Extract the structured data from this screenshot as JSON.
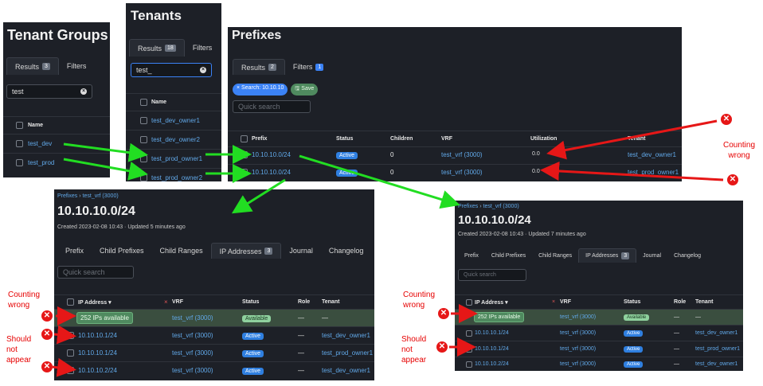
{
  "tenant_groups": {
    "title": "Tenant Groups",
    "tabs": [
      {
        "label": "Results",
        "count": "3"
      },
      {
        "label": "Filters"
      }
    ],
    "search_value": "test",
    "columns": [
      "Name"
    ],
    "rows": [
      "test_dev",
      "test_prod"
    ]
  },
  "tenants": {
    "title": "Tenants",
    "tabs": [
      {
        "label": "Results",
        "count": "18"
      },
      {
        "label": "Filters"
      }
    ],
    "search_value": "test_",
    "columns": [
      "Name"
    ],
    "rows": [
      "test_dev_owner1",
      "test_dev_owner2",
      "test_prod_owner1",
      "test_prod_owner2"
    ]
  },
  "prefixes": {
    "title": "Prefixes",
    "tabs": [
      {
        "label": "Results",
        "count": "2"
      },
      {
        "label": "Filters",
        "count": "1"
      }
    ],
    "search_pill": "Search: 10.10.10",
    "save_label": "Save",
    "quick_search_placeholder": "Quick search",
    "columns": [
      "Prefix",
      "Status",
      "Children",
      "VRF",
      "Utilization",
      "Tenant"
    ],
    "rows": [
      {
        "prefix": "10.10.10.0/24",
        "status": "Active",
        "children": "0",
        "vrf": "test_vrf (3000)",
        "util_label": "0.0",
        "tenant": "test_dev_owner1"
      },
      {
        "prefix": "10.10.10.0/24",
        "status": "Active",
        "children": "0",
        "vrf": "test_vrf (3000)",
        "util_label": "0.0",
        "tenant": "test_prod_owner1"
      }
    ]
  },
  "detail_a": {
    "breadcrumb": [
      "Prefixes",
      "test_vrf (3000)"
    ],
    "title": "10.10.10.0/24",
    "meta": "Created 2023-02-08 10:43 · Updated 5 minutes ago",
    "tabs": [
      {
        "label": "Prefix"
      },
      {
        "label": "Child Prefixes"
      },
      {
        "label": "Child Ranges"
      },
      {
        "label": "IP Addresses",
        "count": "3"
      },
      {
        "label": "Journal"
      },
      {
        "label": "Changelog"
      }
    ],
    "quick_search_placeholder": "Quick search",
    "columns": [
      "IP Address",
      "VRF",
      "Status",
      "Role",
      "Tenant"
    ],
    "available": {
      "label": "252 IPs available",
      "vrf": "test_vrf (3000)",
      "status": "Available",
      "role": "—",
      "tenant": "—"
    },
    "rows": [
      {
        "ip": "10.10.10.1/24",
        "vrf": "test_vrf (3000)",
        "status": "Active",
        "role": "—",
        "tenant": "test_dev_owner1"
      },
      {
        "ip": "10.10.10.1/24",
        "vrf": "test_vrf (3000)",
        "status": "Active",
        "role": "—",
        "tenant": "test_prod_owner1"
      },
      {
        "ip": "10.10.10.2/24",
        "vrf": "test_vrf (3000)",
        "status": "Active",
        "role": "—",
        "tenant": "test_dev_owner1"
      }
    ]
  },
  "detail_b": {
    "breadcrumb": [
      "Prefixes",
      "test_vrf (3000)"
    ],
    "title": "10.10.10.0/24",
    "meta": "Created 2023-02-08 10:43 · Updated 7 minutes ago",
    "tabs": [
      {
        "label": "Prefix"
      },
      {
        "label": "Child Prefixes"
      },
      {
        "label": "Child Ranges"
      },
      {
        "label": "IP Addresses",
        "count": "3"
      },
      {
        "label": "Journal"
      },
      {
        "label": "Changelog"
      }
    ],
    "quick_search_placeholder": "Quick search",
    "columns": [
      "IP Address",
      "VRF",
      "Status",
      "Role",
      "Tenant"
    ],
    "available": {
      "label": "252 IPs available",
      "vrf": "test_vrf (3000)",
      "status": "Available",
      "role": "—",
      "tenant": "—"
    },
    "rows": [
      {
        "ip": "10.10.10.1/24",
        "vrf": "test_vrf (3000)",
        "status": "Active",
        "role": "—",
        "tenant": "test_dev_owner1"
      },
      {
        "ip": "10.10.10.1/24",
        "vrf": "test_vrf (3000)",
        "status": "Active",
        "role": "—",
        "tenant": "test_prod_owner1"
      },
      {
        "ip": "10.10.10.2/24",
        "vrf": "test_vrf (3000)",
        "status": "Active",
        "role": "—",
        "tenant": "test_dev_owner1"
      }
    ]
  },
  "annotations": {
    "counting_wrong": "Counting wrong",
    "counting_wrong_lines": [
      "Counting",
      "wrong"
    ],
    "should_not_appear_lines": [
      "Should",
      "not",
      "appear"
    ]
  },
  "colors": {
    "accent_green": "#22dd22",
    "error_red": "#e61717",
    "panel_bg": "#1d2027",
    "link_blue": "#61a8e8"
  }
}
